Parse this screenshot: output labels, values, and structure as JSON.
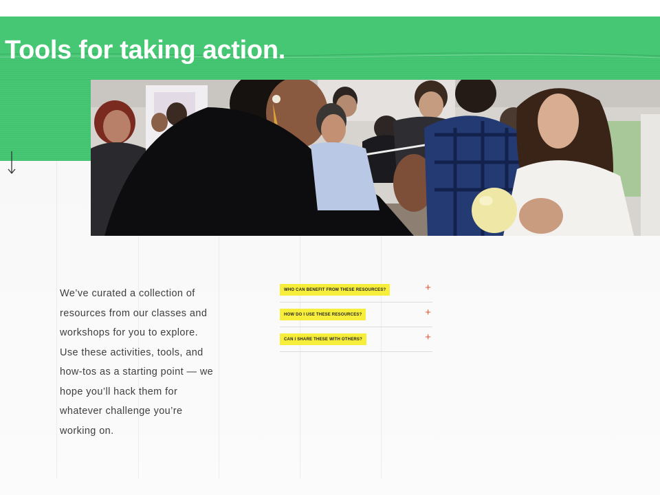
{
  "hero": {
    "title": "Tools for taking action.",
    "colors": {
      "band": "#46c774",
      "title": "#ffffff"
    },
    "scroll_icon": "arrow-down-icon",
    "photo": "workshop-participants-photo"
  },
  "intro": {
    "text": "We’ve curated a collection of resources from our classes and workshops for you to explore. Use these activities, tools, and how-tos as a starting point — we hope you’ll hack them for whatever challenge you’re working on."
  },
  "faq": {
    "items": [
      {
        "question": "WHO CAN BENEFIT FROM THESE RESOURCES?",
        "icon": "plus-icon",
        "toggle": "+"
      },
      {
        "question": "HOW DO I USE THESE RESOURCES?",
        "icon": "plus-icon",
        "toggle": "+"
      },
      {
        "question": "CAN I SHARE THESE WITH OTHERS?",
        "icon": "plus-icon",
        "toggle": "+"
      }
    ],
    "colors": {
      "highlight": "#f7ee3b",
      "plus": "#e8542e"
    }
  }
}
